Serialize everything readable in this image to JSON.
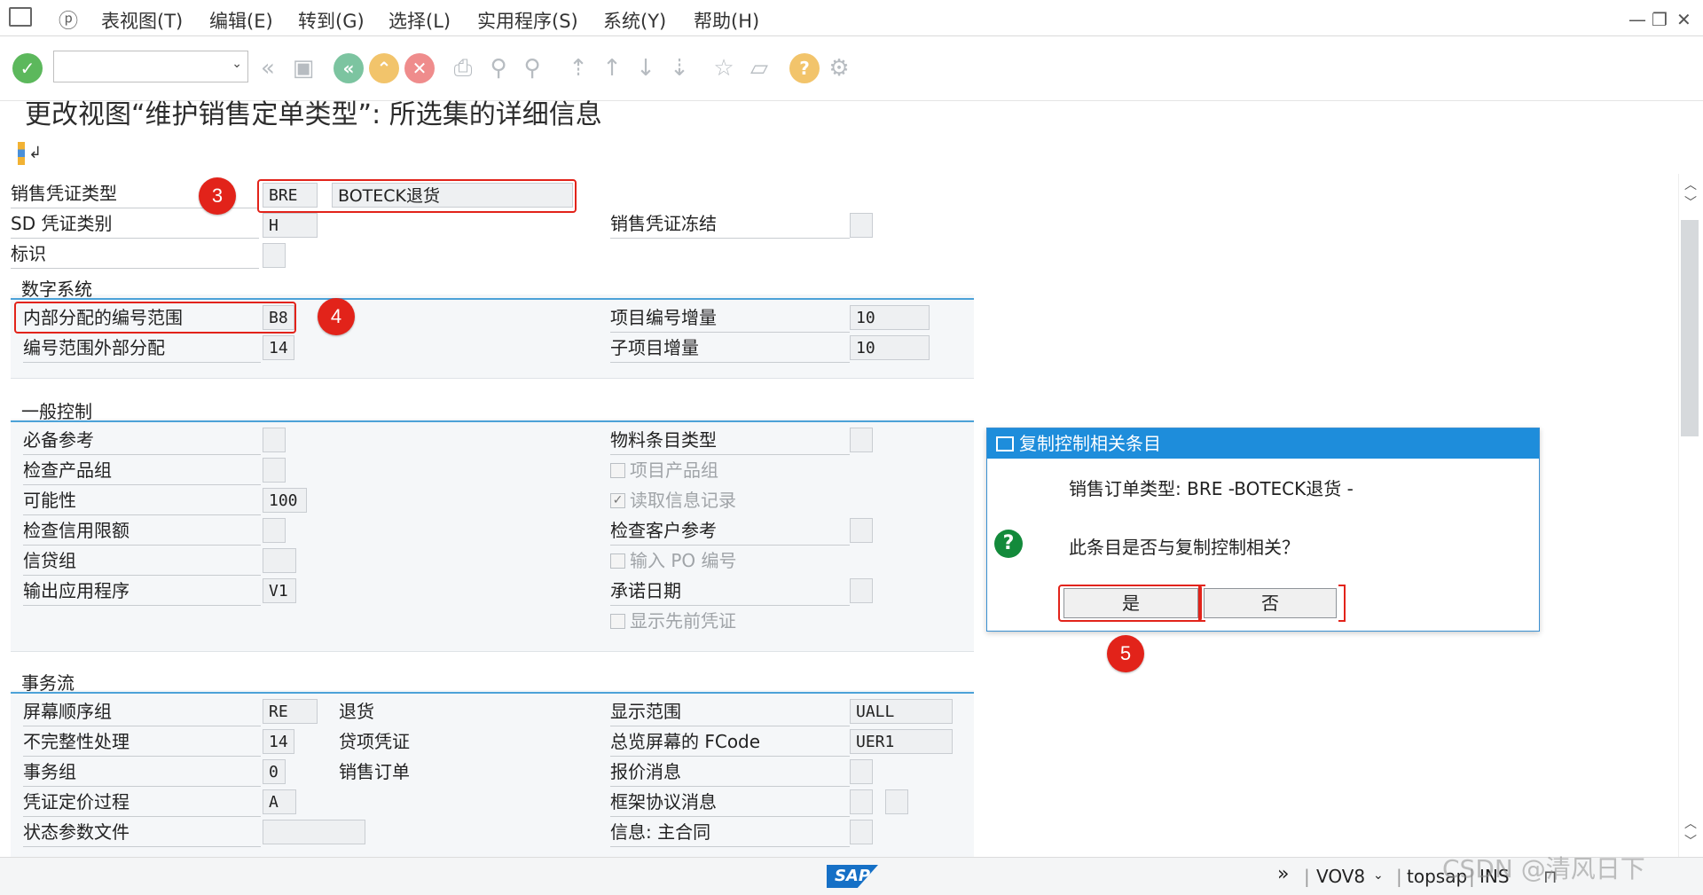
{
  "menu": {
    "items": [
      "表视图(T)",
      "编辑(E)",
      "转到(G)",
      "选择(L)",
      "实用程序(S)",
      "系统(Y)",
      "帮助(H)"
    ],
    "window_controls": [
      "—",
      "❐",
      "✕"
    ]
  },
  "toolbar": {
    "command_field_value": "",
    "icons": [
      "enter-check-icon",
      "back-arrows-icon",
      "save-icon",
      "back-icon",
      "exit-icon",
      "cancel-icon",
      "print-icon",
      "find-icon",
      "find-next-icon",
      "first-page-icon",
      "prev-page-icon",
      "next-page-icon",
      "last-page-icon",
      "new-session-icon",
      "shortcut-icon",
      "help-icon",
      "settings-icon"
    ]
  },
  "title": "更改视图“维护销售定单类型”: 所选集的详细信息",
  "header_fields": {
    "doc_type_label": "销售凭证类型",
    "doc_type_code": "BRE",
    "doc_type_desc": "BOTECK退货",
    "sd_category_label": "SD 凭证类别",
    "sd_category_value": "H",
    "doc_block_label": "销售凭证冻结",
    "indicator_label": "标识"
  },
  "sections": {
    "number_system": {
      "title": "数字系统",
      "internal_range_label": "内部分配的编号范围",
      "internal_range_value": "B8",
      "external_range_label": "编号范围外部分配",
      "external_range_value": "14",
      "item_incr_label": "项目编号增量",
      "item_incr_value": "10",
      "subitem_incr_label": "子项目增量",
      "subitem_incr_value": "10"
    },
    "general_control": {
      "title": "一般控制",
      "reference_mandatory": "必备参考",
      "check_division": "检查产品组",
      "probability": "可能性",
      "probability_value": "100",
      "check_credit": "检查信用限额",
      "credit_group": "信贷组",
      "output_app": "输出应用程序",
      "output_app_value": "V1",
      "material_item_type": "物料条目类型",
      "item_division": "项目产品组",
      "read_info_record": "读取信息记录",
      "check_customer_ref": "检查客户参考",
      "enter_po_number": "输入 PO 编号",
      "commitment_date": "承诺日期",
      "display_preceding": "显示先前凭证"
    },
    "transaction_flow": {
      "title": "事务流",
      "screen_seq_group": "屏幕顺序组",
      "screen_seq_value": "RE",
      "screen_seq_desc": "退货",
      "incompletion": "不完整性处理",
      "incompletion_value": "14",
      "incompletion_desc": "贷项凭证",
      "trans_group": "事务组",
      "trans_group_value": "0",
      "trans_group_desc": "销售订单",
      "pricing_proc": "凭证定价过程",
      "pricing_value": "A",
      "status_profile": "状态参数文件",
      "display_range": "显示范围",
      "display_range_value": "UALL",
      "fcode_overview": "总览屏幕的 FCode",
      "fcode_value": "UER1",
      "quotation_msg": "报价消息",
      "outline_agreement_msg": "框架协议消息",
      "master_contract_msg": "信息: 主合同"
    }
  },
  "annotations": [
    "3",
    "4",
    "5"
  ],
  "dialog": {
    "title": "复制控制相关条目",
    "line1": "销售订单类型: BRE -BOTECK退货 -",
    "question": "此条目是否与复制控制相关？",
    "yes_label": "是",
    "no_label": "否"
  },
  "statusbar": {
    "logo": "SAP",
    "transaction": "VOV8",
    "system": "topsap",
    "mode": "INS",
    "watermark": "CSDN @清风日下"
  }
}
